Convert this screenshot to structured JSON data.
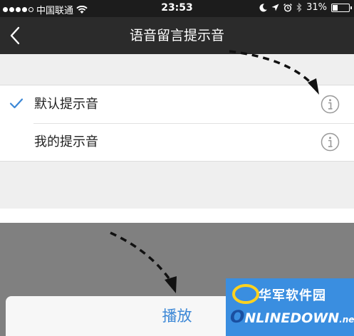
{
  "status_bar": {
    "carrier": "中国联通",
    "time": "23:53",
    "battery": "31%",
    "battery_level": 0.31
  },
  "navbar": {
    "title": "语音留言提示音"
  },
  "tones": [
    {
      "label": "默认提示音",
      "selected": true
    },
    {
      "label": "我的提示音",
      "selected": false
    }
  ],
  "action_sheet": {
    "play_label": "播放"
  },
  "watermark": {
    "cn_text": "华军软件园",
    "en_text": "NLINEDOWN",
    "en_prefix": "O",
    "en_suffix": ".net"
  },
  "colors": {
    "accent": "#3b87d6",
    "navbar": "#2b2b2b"
  }
}
